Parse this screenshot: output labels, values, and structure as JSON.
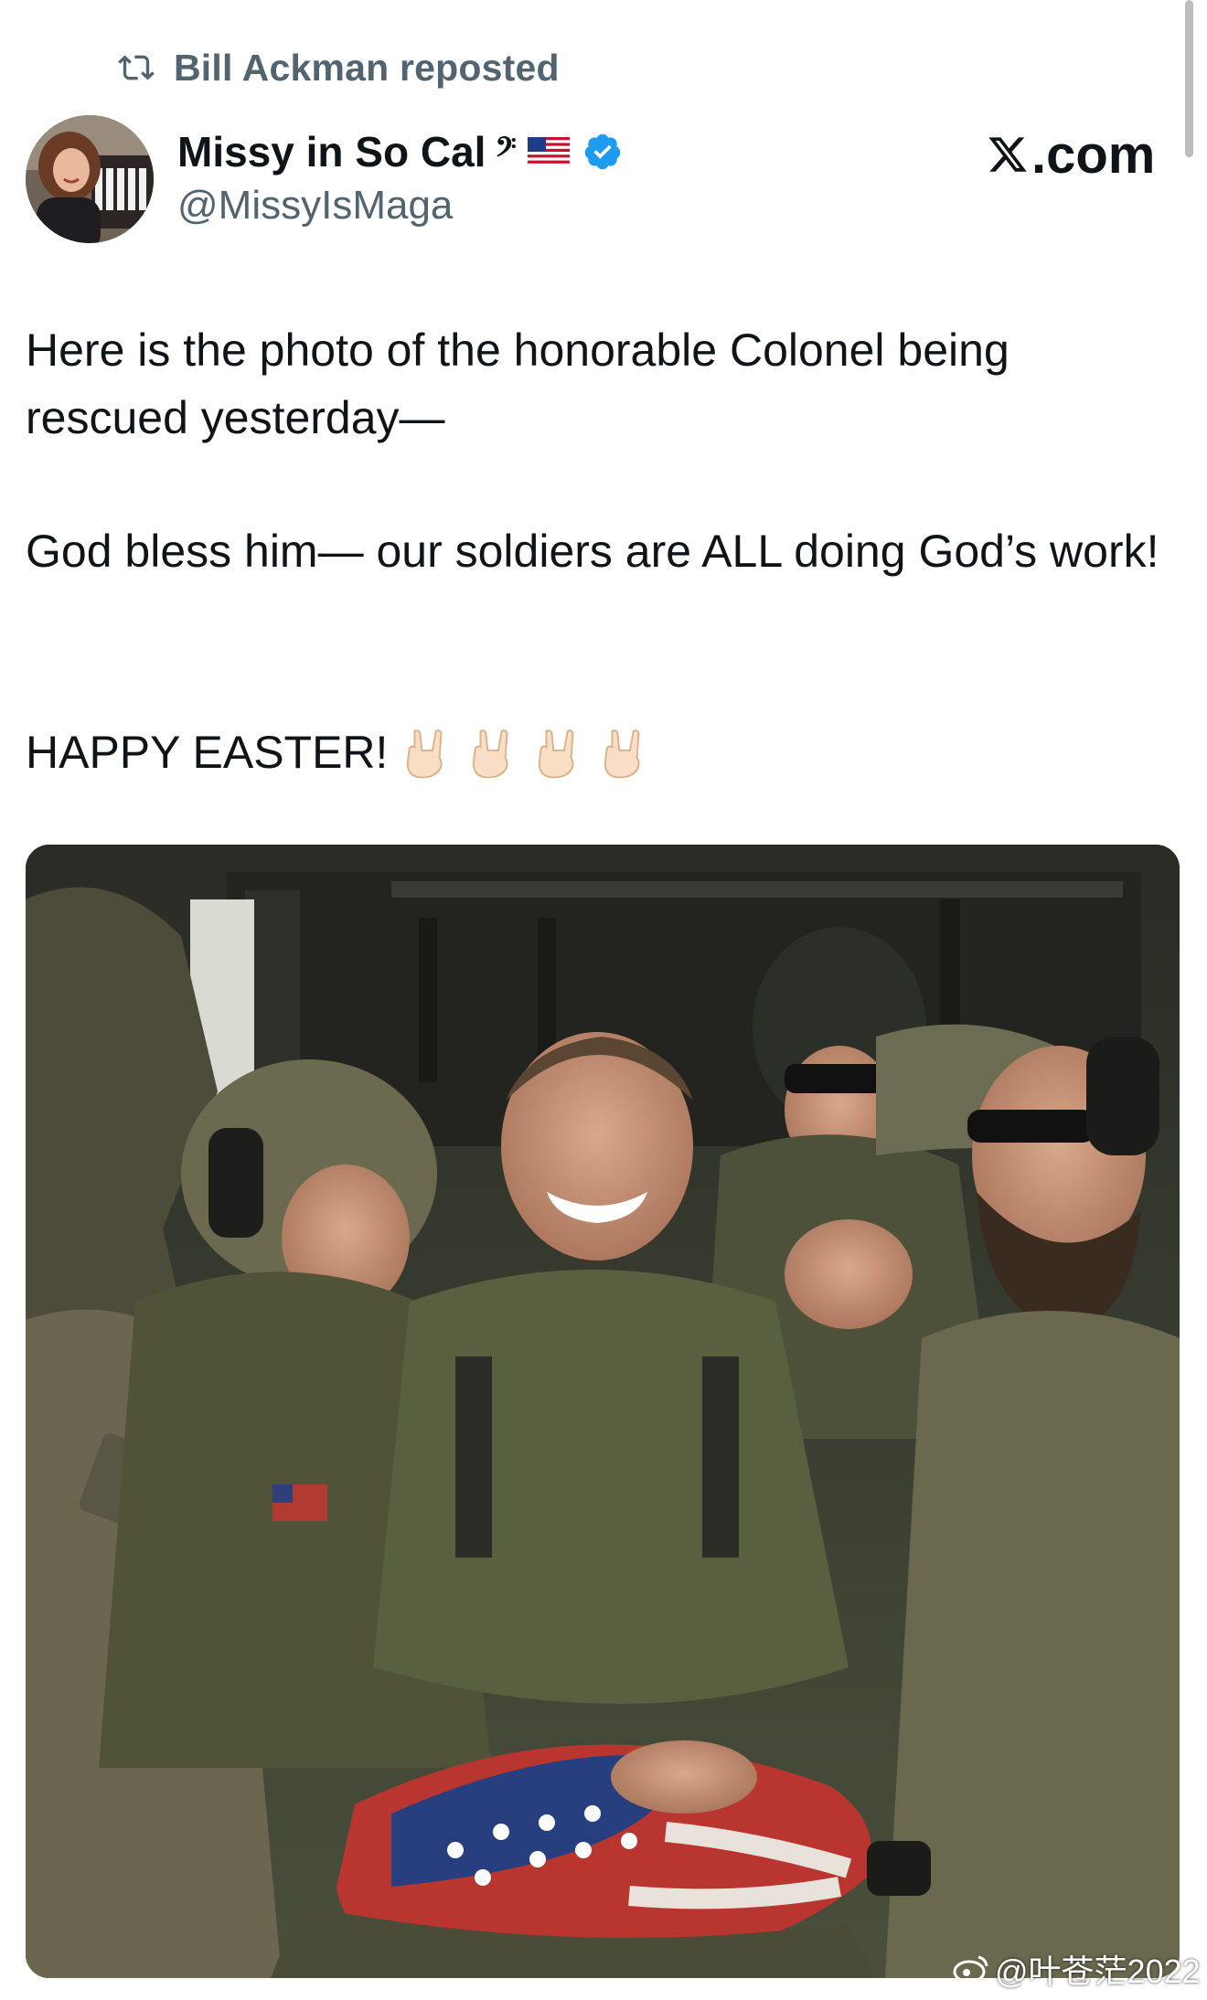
{
  "repost": {
    "icon": "repost-icon",
    "text": "Bill Ackman reposted"
  },
  "author": {
    "name": "Missy in So Cal",
    "name_emoji": [
      "bass-clef-music-emoji",
      "us-flag-emoji"
    ],
    "music_glyph": "𝄢",
    "verified": true,
    "handle": "@MissyIsMaga"
  },
  "brand": {
    "x_logo": "𝕏",
    "text": ".com"
  },
  "tweet": {
    "line1": "Here is the photo of the honorable Colonel being rescued yesterday—",
    "line2": "God bless him— our soldiers are ALL doing God’s work!",
    "line3": "HAPPY EASTER!",
    "emojis": [
      "sign-of-horns-emoji",
      "sign-of-horns-emoji",
      "sign-of-horns-emoji",
      "sign-of-horns-emoji"
    ]
  },
  "photo": {
    "subject": "soldiers-helicopter-photo",
    "watermark": "@叶苍茫2022"
  },
  "colors": {
    "text": "#0f1419",
    "secondary": "#536471",
    "verified": "#1d9bf0",
    "background": "#ffffff"
  }
}
